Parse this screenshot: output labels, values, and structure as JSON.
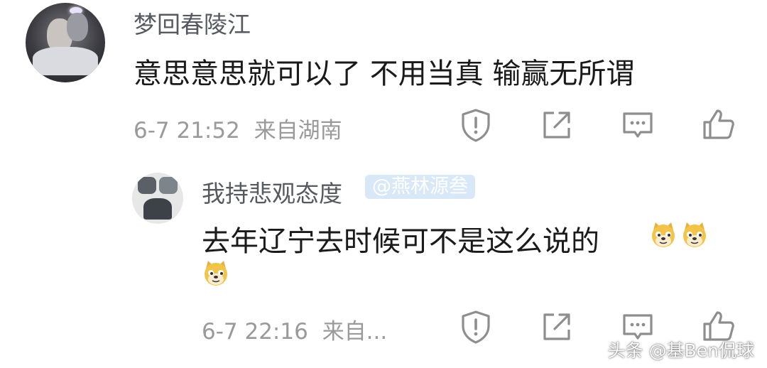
{
  "comment": {
    "username": "梦回春陵江",
    "text": "意思意思就可以了 不用当真 输赢无所谓",
    "timestamp": "6-7 21:52",
    "location": "来自湖南",
    "actions": [
      "shield-icon",
      "share-icon",
      "comment-icon",
      "like-icon"
    ]
  },
  "reply": {
    "username": "我持悲观态度",
    "mention_tag": "@燕林源叁",
    "text_line1": "去年辽宁去时候可不是这么说的",
    "emoji_name": "doge-emoji",
    "timestamp": "6-7 22:16",
    "location": "来自...",
    "actions": [
      "shield-icon",
      "share-icon",
      "comment-icon",
      "like-icon"
    ]
  },
  "watermark": "头条 @基Ben侃球",
  "colors": {
    "meta": "#9a9a9a",
    "username": "#555a60",
    "text": "#1a1a1a",
    "icon": "#8e8e8e",
    "tag_bg": "#d8e8f6",
    "emoji": "#f2c54a"
  }
}
